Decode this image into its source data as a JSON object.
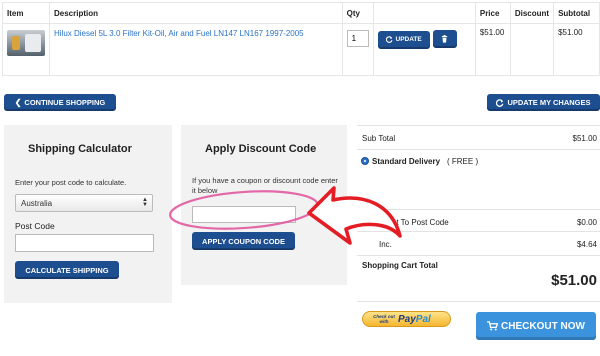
{
  "cart": {
    "headers": {
      "item": "Item",
      "description": "Description",
      "qty": "Qty",
      "price": "Price",
      "discount": "Discount",
      "subtotal": "Subtotal"
    },
    "row": {
      "description": "Hilux Diesel 5L 3.0 Filter Kit-Oil, Air and Fuel LN147 LN167 1997-2005",
      "qty": "1",
      "price": "$51.00",
      "discount": "",
      "subtotal": "$51.00",
      "update_label": "UPDATE"
    }
  },
  "actions": {
    "continue_label": "CONTINUE SHOPPING",
    "update_changes_label": "UPDATE MY CHANGES"
  },
  "shipping": {
    "title": "Shipping Calculator",
    "intro": "Enter your post code to calculate.",
    "country": "Australia",
    "postcode_label": "Post Code",
    "button_label": "CALCULATE SHIPPING"
  },
  "discount": {
    "title": "Apply Discount Code",
    "intro": "If you have a coupon or discount code enter it below",
    "button_label": "APPLY COUPON CODE"
  },
  "totals": {
    "subtotal_label": "Sub Total",
    "subtotal_value": "$51.00",
    "delivery_label": "Standard Delivery",
    "delivery_note": "( FREE )",
    "shipping_label": "ng Cost To Post Code",
    "shipping_value": "$0.00",
    "gst_label": "Inc.",
    "gst_value": "$4.64",
    "cart_total_label": "Shopping Cart Total",
    "grand_total": "$51.00"
  },
  "checkout": {
    "paypal_small": "Check out with",
    "paypal_pay": "Pay",
    "paypal_pal": "Pal",
    "button_label": "CHECKOUT NOW"
  },
  "colors": {
    "button_navy": "#1d4e8f",
    "checkout_blue": "#3a93dc",
    "link_blue": "#2a73c8",
    "annotation_red": "#e41d25",
    "annotation_pink": "#e0509a"
  }
}
